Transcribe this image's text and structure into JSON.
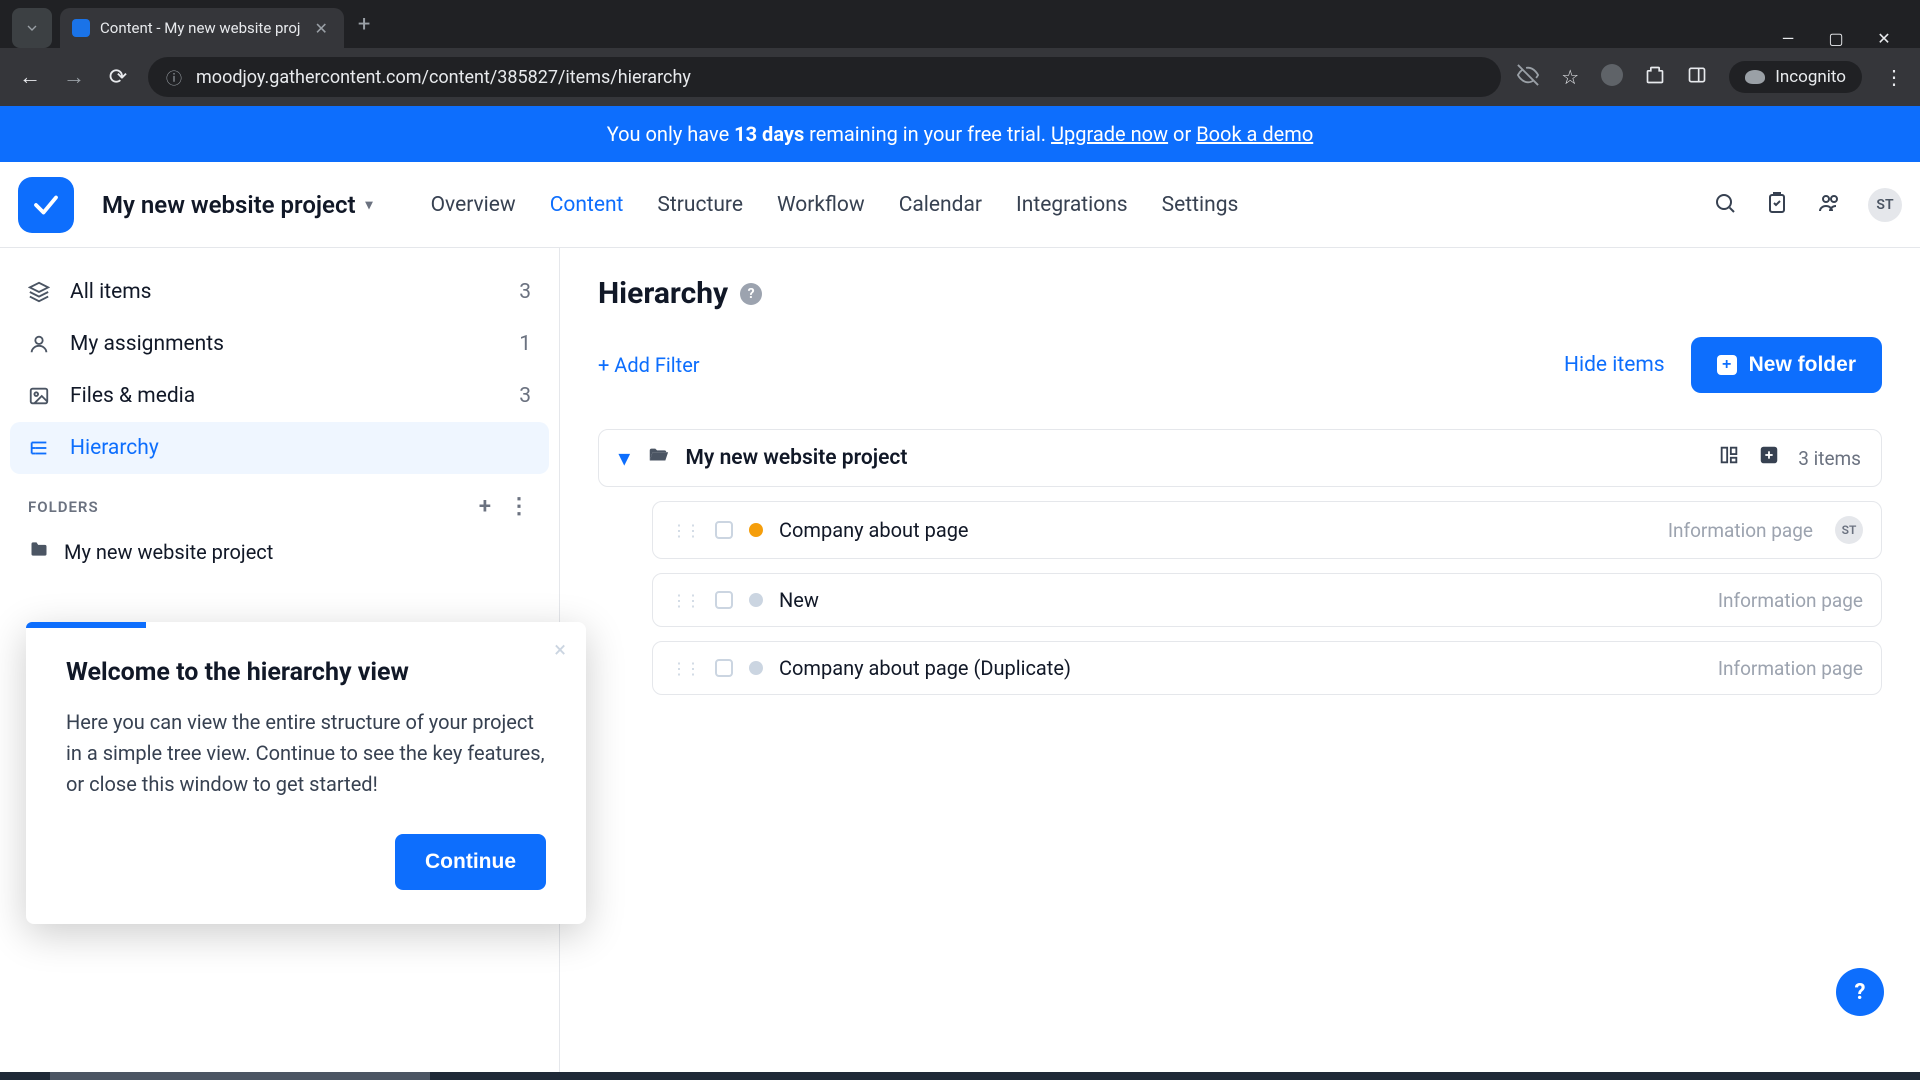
{
  "browser": {
    "tab_title": "Content - My new website proj",
    "url": "moodjoy.gathercontent.com/content/385827/items/hierarchy",
    "incognito_label": "Incognito"
  },
  "banner": {
    "prefix": "You only have ",
    "days": "13 days",
    "middle": " remaining in your free trial. ",
    "upgrade": "Upgrade now",
    "or": " or ",
    "demo": "Book a demo"
  },
  "header": {
    "project_name": "My new website project",
    "tabs": [
      "Overview",
      "Content",
      "Structure",
      "Workflow",
      "Calendar",
      "Integrations",
      "Settings"
    ],
    "active_tab_index": 1,
    "avatar": "ST"
  },
  "sidebar": {
    "items": [
      {
        "label": "All items",
        "count": "3"
      },
      {
        "label": "My assignments",
        "count": "1"
      },
      {
        "label": "Files & media",
        "count": "3"
      },
      {
        "label": "Hierarchy",
        "count": ""
      }
    ],
    "active_index": 3,
    "section_label": "FOLDERS",
    "folders": [
      {
        "label": "My new website project"
      }
    ]
  },
  "main": {
    "title": "Hierarchy",
    "add_filter": "+ Add Filter",
    "hide_items": "Hide items",
    "new_folder": "New folder",
    "root_label": "My new website project",
    "item_count": "3 items",
    "items": [
      {
        "title": "Company about page",
        "type": "Information page",
        "status": "orange",
        "assignee": "ST"
      },
      {
        "title": "New",
        "type": "Information page",
        "status": "gray",
        "assignee": ""
      },
      {
        "title": "Company about page (Duplicate)",
        "type": "Information page",
        "status": "gray",
        "assignee": ""
      }
    ]
  },
  "popover": {
    "title": "Welcome to the hierarchy view",
    "body": "Here you can view the entire structure of your project in a simple tree view. Continue to see the key features, or close this window to get started!",
    "continue": "Continue"
  }
}
